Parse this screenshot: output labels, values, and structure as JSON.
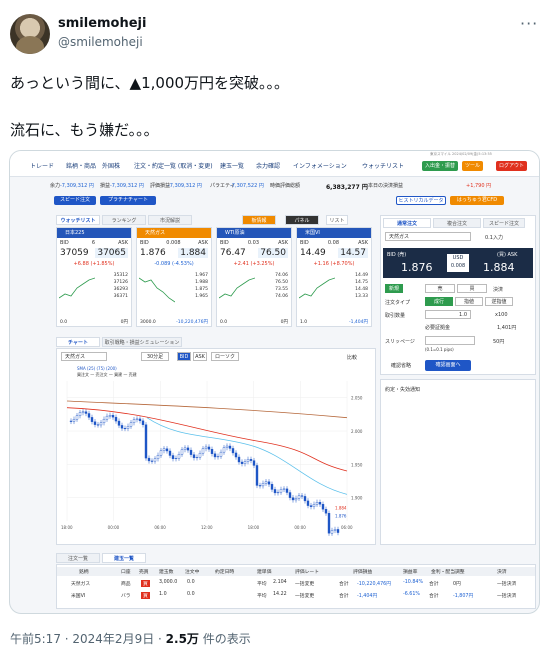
{
  "tweet": {
    "display_name": "smilemoheji",
    "handle": "@smilemoheji",
    "more": "···",
    "line1": "あっという間に、▲1,000万円を突破。。。",
    "line2": "流石に、もう嫌だ。。。",
    "time": "午前5:17 · 2024年2月9日 · ",
    "views_num": "2.5万",
    "views_label": " 件の表示"
  },
  "app": {
    "nav": [
      "トレード",
      "銘柄・商品",
      "外国株",
      "注文・約定一覧 (取消・変更)",
      "建玉一覧",
      "余力確認",
      "インフォメーション",
      "ウォッチリスト"
    ],
    "top_buttons": [
      "入出金・振替",
      "ツール",
      "ログアウト"
    ],
    "clock": "東京スマイル 2024/02/09(金)5:13:55",
    "summary": {
      "labels": [
        "余力",
        "損益",
        "評価損益",
        "時価評価",
        "パラエティ",
        "時価評価総額",
        "本日の決済損益"
      ],
      "values": [
        "-7,309,312 円",
        "-7,309,312 円",
        "-7,309,312 円",
        "-7,307,522 円",
        "6,383,277 円",
        "+1,790 円"
      ]
    },
    "sub_buttons": [
      "スピード注文",
      "プラチナチャート",
      "ヒストリカルデータ",
      "はっちゅう君CFD"
    ],
    "watch_tabs": [
      "ウォッチリスト",
      "ランキング",
      "市況解説"
    ],
    "view_toggles": [
      "板情報",
      "パネル",
      "リスト"
    ],
    "cards": [
      {
        "name": "日本225",
        "bid_label": "BID",
        "spread": "6",
        "ask_label": "ASK",
        "bid": "37059",
        "ask": "37065",
        "change": "+6.88 (+1.85%)",
        "vals": [
          "35312",
          "37126",
          "36293",
          "36371"
        ],
        "f1": "0.0",
        "f2": "0円"
      },
      {
        "name": "天然ガス",
        "bid_label": "BID",
        "spread": "0.008",
        "ask_label": "ASK",
        "bid": "1.876",
        "ask": "1.884",
        "change": "-0.089 (-4.53%)",
        "vals": [
          "1.967",
          "1.988",
          "1.875",
          "1.965"
        ],
        "f1": "3000.0",
        "f2": "-10,220,476円"
      },
      {
        "name": "WTI原油",
        "bid_label": "BID",
        "spread": "0.03",
        "ask_label": "ASK",
        "bid": "76.47",
        "ask": "76.50",
        "change": "+2.41 (+3.25%)",
        "vals": [
          "74.06",
          "76.50",
          "73.55",
          "74.06"
        ],
        "f1": "0.0",
        "f2": "0円"
      },
      {
        "name": "米国VI",
        "bid_label": "BID",
        "spread": "0.08",
        "ask_label": "ASK",
        "bid": "14.49",
        "ask": "14.57",
        "change": "+1.16 (+8.70%)",
        "vals": [
          "14.49",
          "14.75",
          "14.48",
          "13.33"
        ],
        "f1": "1.0",
        "f2": "-1,404円"
      }
    ],
    "order": {
      "tabs": [
        "通常注文",
        "複合注文",
        "スピード注文"
      ],
      "symbol": "天然ガス",
      "qty_label": "0.1入力",
      "bid_label": "BID (売)",
      "bid": "1.876",
      "usd": "USD",
      "spread": "0.008",
      "ask_label": "(買) ASK",
      "ask": "1.884",
      "new_tag": "新規",
      "sell": "売",
      "buy": "買",
      "settle": "決済",
      "type_label": "注文タイプ",
      "types": [
        "成行",
        "指値",
        "逆指値"
      ],
      "lot_label": "取引数量",
      "lot_value": "1.0",
      "lot_unit": "x100",
      "margin_label": "必要証拠金",
      "margin_value": "1,401円",
      "slip_label": "スリッページ",
      "slip_note": "(0.1=0.1 pips)",
      "slip_unit": "50円",
      "confirm_label": "確認省略",
      "confirm_btn": "確認画面へ",
      "notice": "約定・失効通知"
    },
    "chart": {
      "tabs": [
        "チャート",
        "取引戦略・損益シミュレーション"
      ],
      "symbol": "天然ガス",
      "interval": "30分足",
      "bid_ask": [
        "BID",
        "ASK"
      ],
      "style": "ローソク",
      "compare": "比較",
      "legend": "SMA (25) (75) (200)",
      "legend2": "買注文 — 売注文 — 買建 — 売建",
      "y_ticks": [
        "2.050",
        "2.000",
        "1.950",
        "1.900"
      ],
      "x_ticks": [
        "18:00",
        "00:00",
        "06:00",
        "12:00",
        "18:00",
        "00:00",
        "06:00"
      ],
      "ask_tag": "1.884",
      "bid_tag": "1.876"
    },
    "positions": {
      "tabs": [
        "注文一覧",
        "建玉一覧"
      ],
      "headers": [
        "銘柄",
        "口座",
        "売買",
        "建玉数",
        "注文中",
        "約定日時",
        "建単価",
        "評価レート",
        "評価損益",
        "損益率",
        "金利・配当調整",
        "決済"
      ],
      "rows": [
        {
          "name": "天然ガス",
          "acct": "商品",
          "side": "買",
          "qty": "3,000.0",
          "pending": "0.0",
          "avg": "平均",
          "price": "2.104",
          "mode": "一括変更",
          "total": "合計",
          "pl": "-10,220,476円",
          "rate": "-10.84%",
          "total2": "合計",
          "adj": "0円",
          "settle": "一括決済"
        },
        {
          "name": "米国VI",
          "acct": "バラ",
          "side": "買",
          "qty": "1.0",
          "pending": "0.0",
          "avg": "平均",
          "price": "14.22",
          "mode": "一括変更",
          "total": "合計",
          "pl": "-1,404円",
          "rate": "-6.61%",
          "total2": "合計",
          "adj": "-1,807円",
          "settle": "一括決済"
        }
      ]
    }
  },
  "colors": {
    "brand": "#1f56c6",
    "panel_head": "#2456b9",
    "selected": "#f08a00",
    "loss": "#1c60d2",
    "gain": "#e0301e",
    "quote_bg": "#1b2c46"
  }
}
